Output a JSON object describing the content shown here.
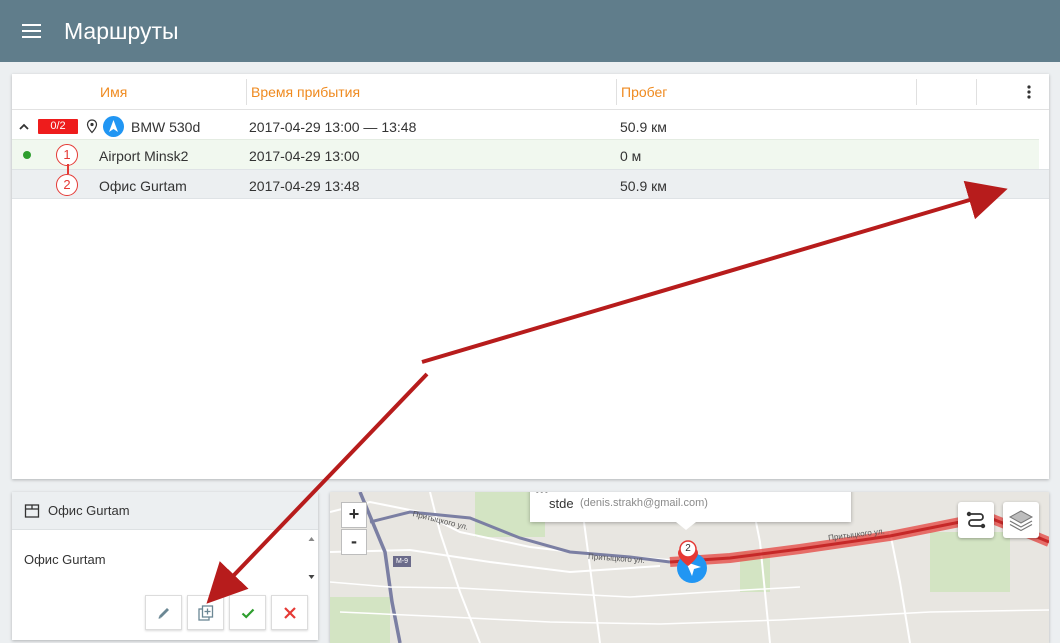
{
  "app": {
    "title": "Маршруты"
  },
  "table": {
    "columns": {
      "name": "Имя",
      "arrival": "Время прибытия",
      "mileage": "Пробег"
    },
    "route": {
      "badge": "0/2",
      "unit": "BMW 530d",
      "arrival": "2017-04-29 13:00 — 13:48",
      "mileage": "50.9 км"
    },
    "points": [
      {
        "num": "1",
        "name": "Airport Minsk2",
        "arrival": "2017-04-29 13:00",
        "mileage": "0 м"
      },
      {
        "num": "2",
        "name": "Офис Gurtam",
        "arrival": "2017-04-29 13:48",
        "mileage": "50.9 км"
      }
    ]
  },
  "editor": {
    "title": "Офис Gurtam",
    "text": "Офис Gurtam"
  },
  "map": {
    "zoom_in": "+",
    "zoom_out": "-",
    "popup": {
      "dots": "•••",
      "name": "stde",
      "email": "(denis.strakh@gmail.com)"
    },
    "marker_num": "2",
    "road_badge": "M-9",
    "streets": [
      "Притыцкого ул.",
      "Притыцкого ул.",
      "Притыцкого ул."
    ]
  },
  "colors": {
    "appbar": "#607d8b",
    "header_text": "#ef8a1f",
    "badge": "#ee1c1c",
    "route_line": "#e53935",
    "arrow": "#b71c1c"
  }
}
